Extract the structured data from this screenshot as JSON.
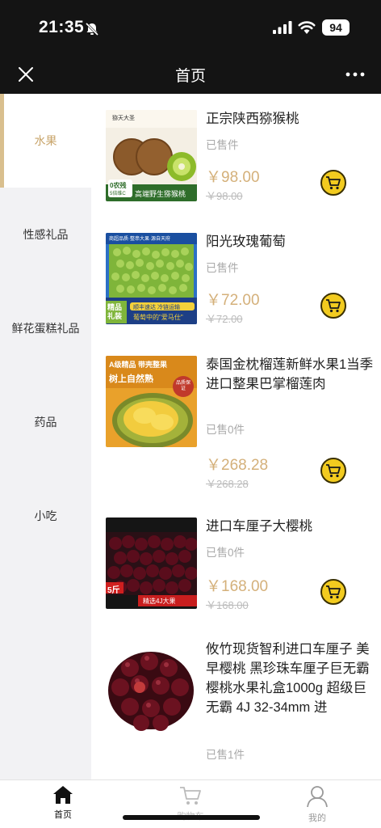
{
  "status_bar": {
    "time": "21:35",
    "battery": "94"
  },
  "nav": {
    "title": "首页"
  },
  "sidebar": {
    "items": [
      {
        "label": "水果"
      },
      {
        "label": "性感礼品"
      },
      {
        "label": "鲜花蛋糕礼品"
      },
      {
        "label": "药品"
      },
      {
        "label": "小吃"
      }
    ]
  },
  "products": [
    {
      "name": "正宗陕西猕猴桃",
      "sold": "已售件",
      "price": "￥98.00",
      "old_price": "￥98.00",
      "image_text": {
        "brand": "猕天大圣",
        "tag1": "0农残",
        "tag2": "5倍维C",
        "banner": "高端野生猕猴桃"
      }
    },
    {
      "name": "阳光玫瑰葡萄",
      "sold": "已售件",
      "price": "￥72.00",
      "old_price": "￥72.00",
      "image_text": {
        "top": "商超品质·整串大果·源自天府",
        "badge": "精品礼装",
        "line1": "顺丰速达 冷链运输",
        "line2": "葡萄中的\"爱马仕\""
      }
    },
    {
      "name": "泰国金枕榴莲新鲜水果1当季进口整果巴掌榴莲肉",
      "sold": "已售0件",
      "price": "￥268.28",
      "old_price": "￥268.28",
      "image_text": {
        "line1": "A级精品 带壳整果",
        "line2": "树上自然熟",
        "stamp": "品质保证"
      }
    },
    {
      "name": "进口车厘子大樱桃",
      "sold": "已售0件",
      "price": "￥168.00",
      "old_price": "￥168.00",
      "image_text": {
        "tag": "5斤",
        "banner": "精选4J大果"
      }
    },
    {
      "name": "攸竹现货智利进口车厘子 美早樱桃 黑珍珠车厘子巨无霸樱桃水果礼盒1000g 超级巨无霸 4J 32-34mm 进",
      "sold": "已售1件"
    }
  ],
  "tabbar": {
    "items": [
      {
        "label": "首页",
        "icon": "home-icon"
      },
      {
        "label": "购物车",
        "icon": "cart-icon"
      },
      {
        "label": "我的",
        "icon": "user-icon"
      }
    ]
  },
  "colors": {
    "accent": "#d4b07a",
    "cart_button": "#f2cb1f",
    "status_bg": "#141414",
    "sidebar_bg": "#f2f2f4"
  }
}
